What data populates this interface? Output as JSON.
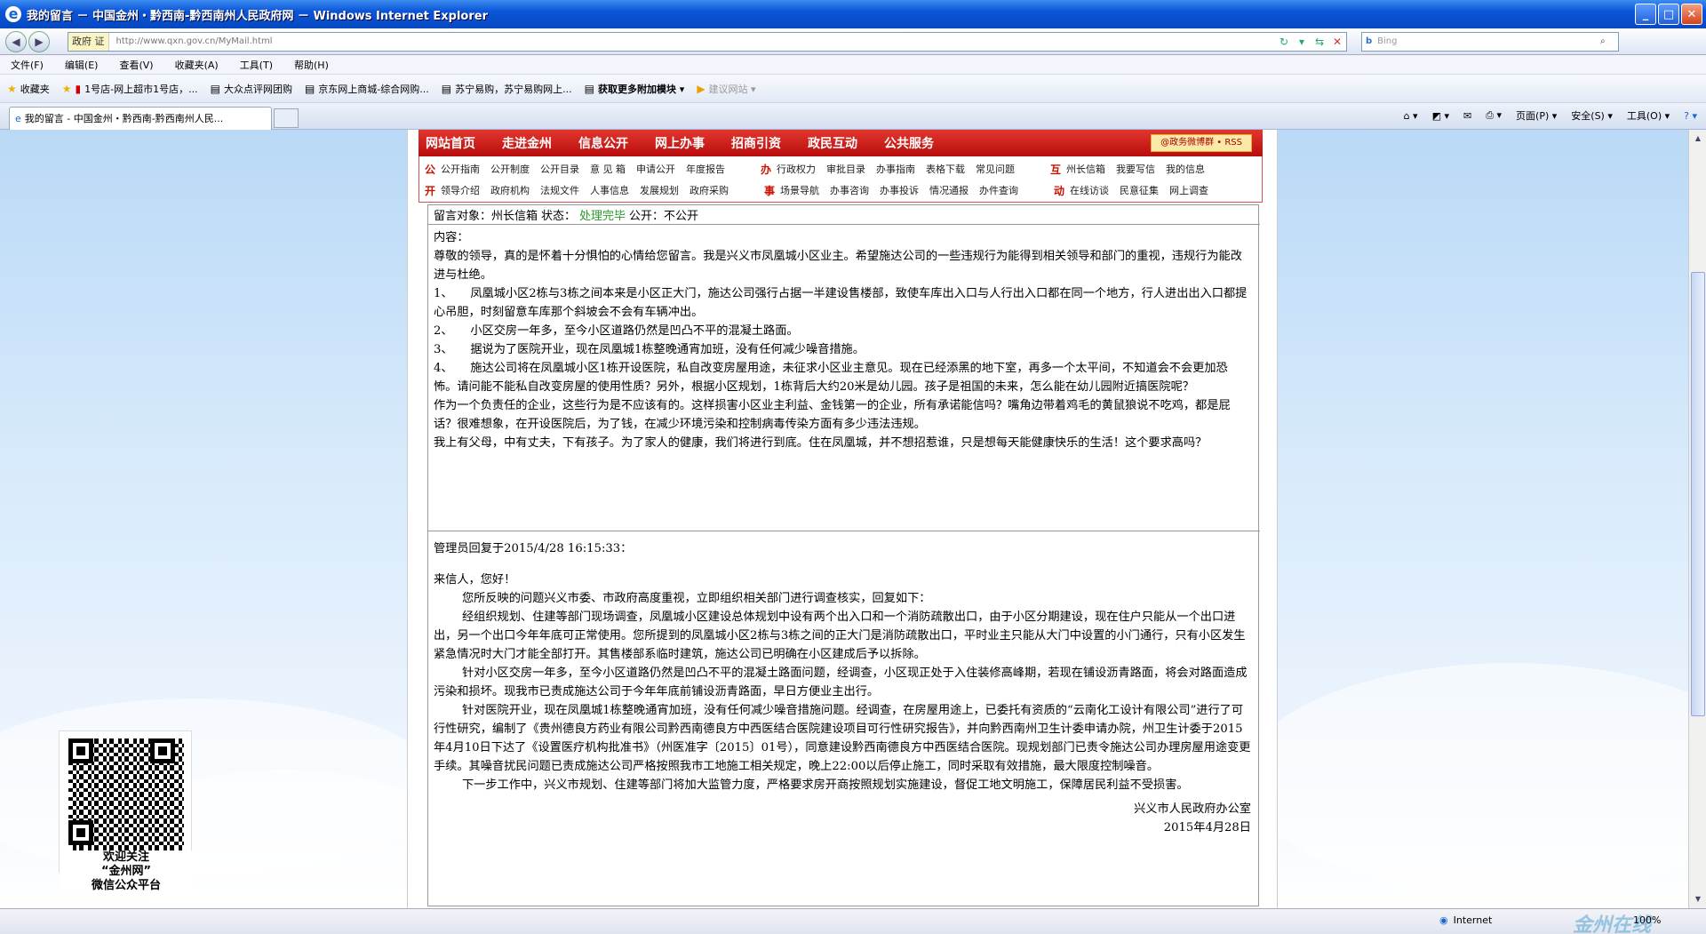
{
  "window": {
    "title": "我的留言 － 中国金州・黔西南-黔西南州人民政府网 － Windows Internet Explorer"
  },
  "address": {
    "tag": "政府 证",
    "url": "http://www.qxn.gov.cn/MyMail.html",
    "search_placeholder": "Bing",
    "search_brand": "b"
  },
  "menu": [
    "文件(F)",
    "编辑(E)",
    "查看(V)",
    "收藏夹(A)",
    "工具(T)",
    "帮助(H)"
  ],
  "favorites": [
    "收藏夹",
    "1号店-网上超市1号店，...",
    "大众点评网团购",
    "京东网上商城-综合网购...",
    "苏宁易购，苏宁易购网上...",
    "获取更多附加模块 ▾",
    "建议网站 ▾"
  ],
  "tab": {
    "label": "我的留言 - 中国金州・黔西南-黔西南州人民...",
    "cmds": [
      "页面(P) ▾",
      "安全(S) ▾",
      "工具(O) ▾"
    ]
  },
  "site": {
    "nav": [
      "网站首页",
      "走进金州",
      "信息公开",
      "网上办事",
      "招商引资",
      "政民互动",
      "公共服务"
    ],
    "rss": "@政务微博群 • RSS",
    "sub1": {
      "lead": "公",
      "items": [
        "公开指南",
        "公开制度",
        "公开目录",
        "意 见 箱",
        "申请公开",
        "年度报告"
      ],
      "lead2": "办",
      "items2": [
        "行政权力",
        "审批目录",
        "办事指南",
        "表格下载",
        "常见问题"
      ],
      "lead3": "互",
      "items3": [
        "州长信箱",
        "我要写信",
        "我的信息"
      ]
    },
    "sub2": {
      "lead": "开",
      "items": [
        "领导介绍",
        "政府机构",
        "法规文件",
        "人事信息",
        "发展规划",
        "政府采购"
      ],
      "lead2": "事",
      "items2": [
        "场景导航",
        "办事咨询",
        "办事投诉",
        "情况通报",
        "办件查询"
      ],
      "lead3": "动",
      "items3": [
        "在线访谈",
        "民意征集",
        "网上调查"
      ]
    }
  },
  "message": {
    "target_label": "留言对象：州长信箱",
    "status_label": "状态：",
    "status": "处理完毕",
    "public": "公开：不公开",
    "content_label": "内容：",
    "paragraphs": [
      "尊敬的领导，真的是怀着十分惧怕的心情给您留言。我是兴义市凤凰城小区业主。希望施达公司的一些违规行为能得到相关领导和部门的重视，违规行为能改进与杜绝。",
      "1、　　凤凰城小区2栋与3栋之间本来是小区正大门，施达公司强行占据一半建设售楼部，致使车库出入口与人行出入口都在同一个地方，行人进出出入口都提心吊胆，时刻留意车库那个斜坡会不会有车辆冲出。",
      "2、　　小区交房一年多，至今小区道路仍然是凹凸不平的混凝土路面。",
      "3、　　据说为了医院开业，现在凤凰城1栋整晚通宵加班，没有任何减少噪音措施。",
      "4、　　施达公司将在凤凰城小区1栋开设医院，私自改变房屋用途，未征求小区业主意见。现在已经添黑的地下室，再多一个太平间，不知道会不会更加恐怖。请问能不能私自改变房屋的使用性质？另外，根据小区规划，1栋背后大约20米是幼儿园。孩子是祖国的未来，怎么能在幼儿园附近搞医院呢？",
      "作为一个负责任的企业，这些行为是不应该有的。这样损害小区业主利益、金钱第一的企业，所有承诺能信吗？嘴角边带着鸡毛的黄鼠狼说不吃鸡，都是屁话？很难想象，在开设医院后，为了钱，在减少环境污染和控制病毒传染方面有多少违法违规。",
      "我上有父母，中有丈夫，下有孩子。为了家人的健康，我们将进行到底。住在凤凰城，并不想招惹谁，只是想每天能健康快乐的生活！这个要求高吗？"
    ]
  },
  "reply": {
    "header": "管理员回复于2015/4/28 16:15:33：",
    "greeting": "来信人，您好！",
    "paragraphs": [
      "您所反映的问题兴义市委、市政府高度重视，立即组织相关部门进行调查核实，回复如下：",
      "经组织规划、住建等部门现场调查，凤凰城小区建设总体规划中设有两个出入口和一个消防疏散出口，由于小区分期建设，现在住户只能从一个出口进出，另一个出口今年年底可正常使用。您所提到的凤凰城小区2栋与3栋之间的正大门是消防疏散出口，平时业主只能从大门中设置的小门通行，只有小区发生紧急情况时大门才能全部打开。其售楼部系临时建筑，施达公司已明确在小区建成后予以拆除。",
      "针对小区交房一年多，至今小区道路仍然是凹凸不平的混凝土路面问题，经调查，小区现正处于入住装修高峰期，若现在铺设沥青路面，将会对路面造成污染和损坏。现我市已责成施达公司于今年年底前铺设沥青路面，早日方便业主出行。",
      "针对医院开业，现在凤凰城1栋整晚通宵加班，没有任何减少噪音措施问题。经调查，在房屋用途上，已委托有资质的“云南化工设计有限公司”进行了可行性研究，编制了《贵州德良方药业有限公司黔西南德良方中西医结合医院建设项目可行性研究报告》，并向黔西南州卫生计委申请办院，州卫生计委于2015年4月10日下达了《设置医疗机构批准书》（州医准字〔2015〕01号），同意建设黔西南德良方中西医结合医院。现规划部门已责令施达公司办理房屋用途变更手续。其噪音扰民问题已责成施达公司严格按照我市工地施工相关规定，晚上22:00以后停止施工，同时采取有效措施，最大限度控制噪音。",
      "下一步工作中，兴义市规划、住建等部门将加大监管力度，严格要求房开商按照规划实施建设，督促工地文明施工，保障居民利益不受损害。"
    ],
    "signature": "兴义市人民政府办公室",
    "date": "2015年4月28日"
  },
  "qr": {
    "caption1": "欢迎关注",
    "caption2": "“金州网”",
    "caption3": "微信公众平台"
  },
  "status": {
    "zone": "Internet",
    "zoom": "100%",
    "watermark": "金州在线"
  }
}
